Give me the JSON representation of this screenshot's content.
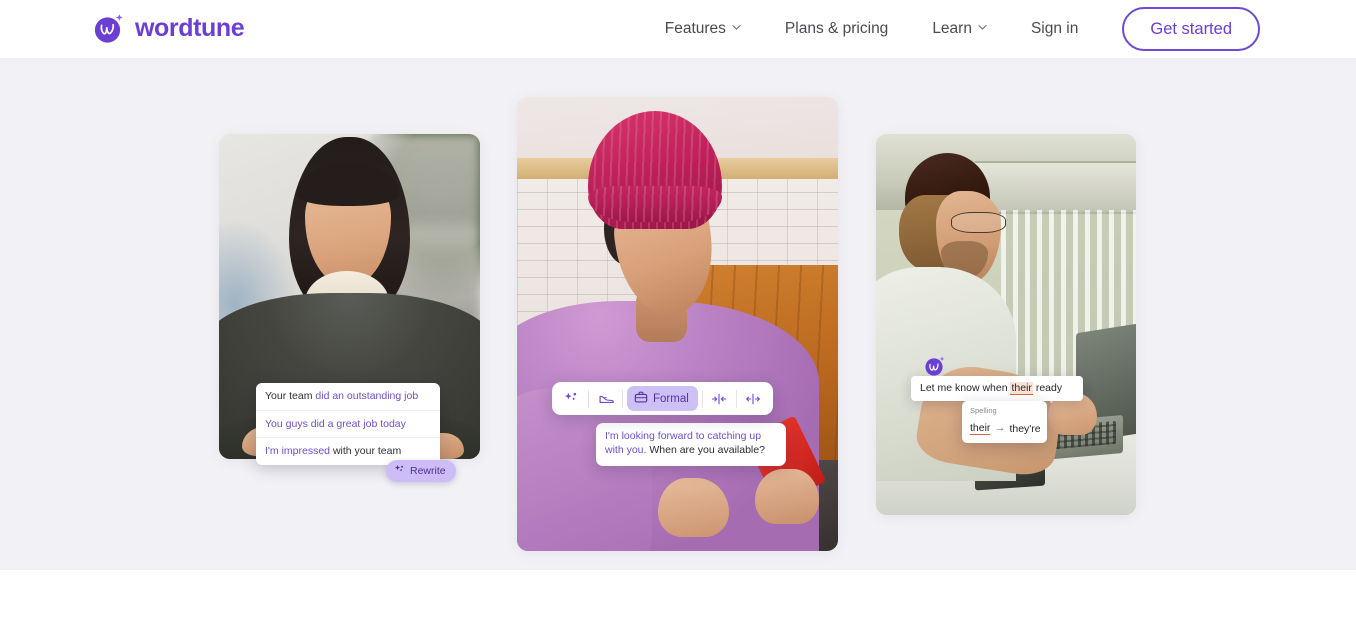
{
  "header": {
    "brand": {
      "name": "wordtune",
      "logo_icon": "wordtune-logo-icon"
    },
    "nav": [
      {
        "label": "Features",
        "has_caret": true,
        "icon": "chevron-down-icon"
      },
      {
        "label": "Plans & pricing",
        "has_caret": false
      },
      {
        "label": "Learn",
        "has_caret": true,
        "icon": "chevron-down-icon"
      },
      {
        "label": "Sign in",
        "has_caret": false
      }
    ],
    "cta_label": "Get started"
  },
  "hero": {
    "cards": [
      {
        "name": "rewrite-suggestions-card",
        "photo_alt": "smiling woman with dark bob haircut in grey knit sweater",
        "overlay": {
          "type": "rewrite-suggestions",
          "suggestions": [
            {
              "prefix": "Your team ",
              "highlight": "did an outstanding job"
            },
            {
              "prefix": "",
              "highlight": "You guys did a great job today"
            },
            {
              "prefix": "",
              "highlight": "I'm impressed ",
              "suffix": "with your team"
            }
          ],
          "button_label": "Rewrite",
          "button_icon": "sparkles-icon"
        }
      },
      {
        "name": "tone-toolbar-card",
        "photo_alt": "person in pink beanie smiling at phone in a cafe",
        "overlay": {
          "type": "tone-toolbar",
          "tools": [
            {
              "name": "sparkles-icon",
              "label": ""
            },
            {
              "name": "casual-shoe-icon",
              "label": ""
            },
            {
              "name": "briefcase-icon",
              "label": "Formal",
              "active": true
            },
            {
              "name": "shorten-icon",
              "label": ""
            },
            {
              "name": "expand-icon",
              "label": ""
            }
          ],
          "result_highlight": "I'm looking forward to catching up with you.",
          "result_plain": " When are you available?"
        }
      },
      {
        "name": "spelling-correction-card",
        "photo_alt": "man with beanie and glasses typing on a laptop in a van",
        "overlay": {
          "type": "spelling-correction",
          "badge_icon": "wordtune-badge-icon",
          "sentence_before": "Let me know when ",
          "sentence_typo": "their",
          "sentence_after": " ready",
          "card_label": "Spelling",
          "fix_from": "their",
          "fix_arrow": "→",
          "fix_to": "they're"
        }
      }
    ]
  },
  "colors": {
    "brand_purple": "#6b3fd4",
    "cta_border": "#7048d8",
    "hero_background": "#f2f2f6",
    "header_background": "#ffffff",
    "suggestion_highlight": "#6b4fd0",
    "chip_background": "#ccc0f4",
    "rewrite_button_background": "#cdbdf6",
    "typo_underline": "#e0603a",
    "typo_background": "#fbe2d4",
    "nav_text": "#4a4a52"
  }
}
